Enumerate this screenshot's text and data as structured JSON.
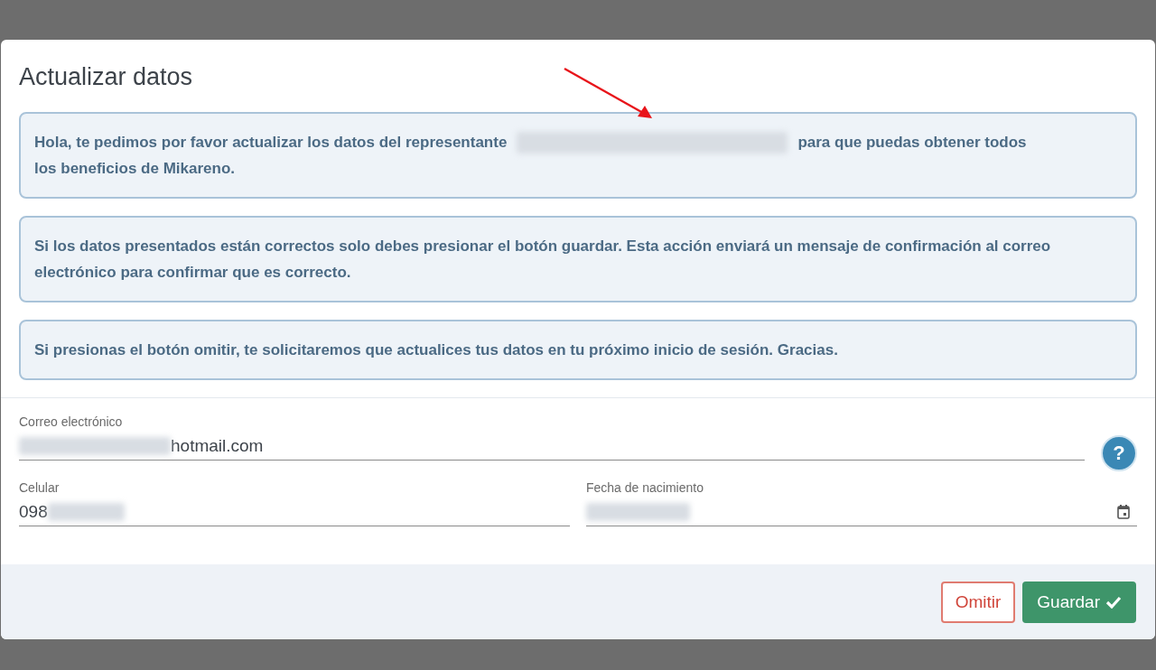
{
  "dialog": {
    "title": "Actualizar datos",
    "messages": [
      {
        "parts": [
          {
            "kind": "text",
            "text": "Hola, te pedimos por favor actualizar los datos del representante"
          },
          {
            "kind": "redacted"
          },
          {
            "kind": "text",
            "text": "para que puedas obtener todos"
          },
          {
            "kind": "text",
            "text": "los beneficios de Mikareno."
          }
        ]
      },
      {
        "parts": [
          {
            "kind": "text",
            "text": "Si los datos presentados están correctos solo debes presionar el botón guardar. Esta acción enviará un mensaje de confirmación al correo electrónico para confirmar que es correcto."
          }
        ]
      },
      {
        "parts": [
          {
            "kind": "text",
            "text": "Si presionas el botón omitir, te solicitaremos que actualices tus datos en tu próximo inicio de sesión. Gracias."
          }
        ]
      }
    ],
    "email": {
      "label": "Correo electrónico",
      "parts": [
        {
          "kind": "redacted"
        },
        {
          "kind": "text",
          "text": "hotmail.com"
        }
      ]
    },
    "help_button": "?",
    "phone": {
      "label": "Celular",
      "parts": [
        {
          "kind": "text",
          "text": "098"
        },
        {
          "kind": "redacted"
        }
      ]
    },
    "birthdate": {
      "label": "Fecha de nacimiento",
      "parts": [
        {
          "kind": "redacted"
        }
      ]
    },
    "buttons": [
      {
        "kind": "secondary",
        "label": "Omitir"
      },
      {
        "kind": "primary",
        "label": "Guardar"
      }
    ]
  }
}
